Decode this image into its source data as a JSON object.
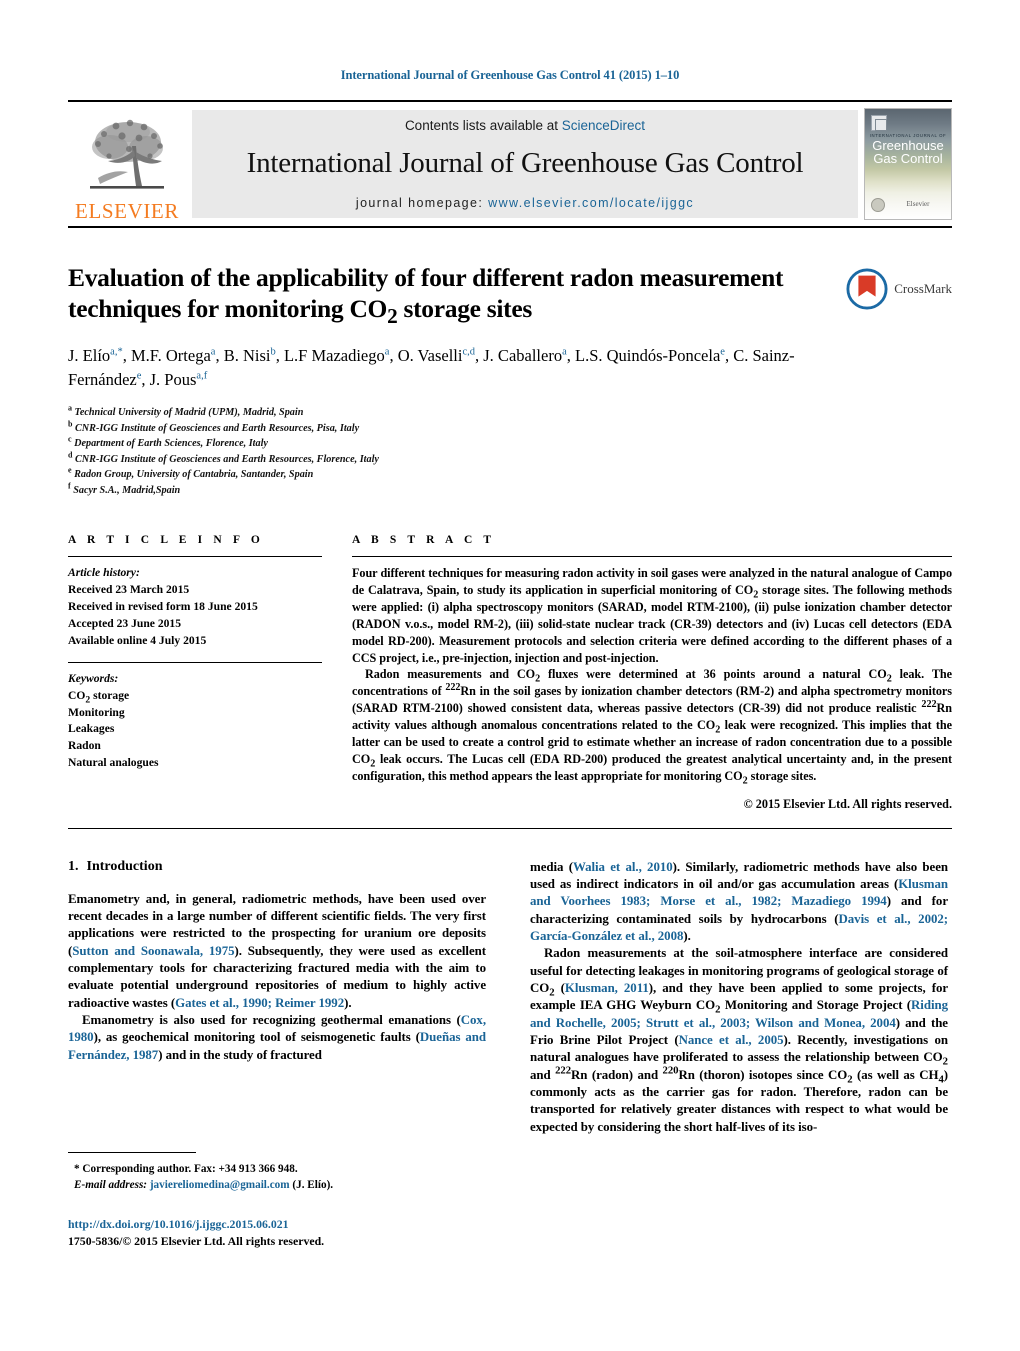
{
  "running_head": "International Journal of Greenhouse Gas Control 41 (2015) 1–10",
  "masthead": {
    "publisher": "ELSEVIER",
    "contents_prefix": "Contents lists available at ",
    "contents_link": "ScienceDirect",
    "journal_title": "International Journal of Greenhouse Gas Control",
    "homepage_label": "journal homepage:",
    "homepage_url": "www.elsevier.com/locate/ijggc",
    "cover": {
      "superline": "INTERNATIONAL JOURNAL OF",
      "line1": "Greenhouse",
      "line2": "Gas Control",
      "badge_word": "Elsevier"
    }
  },
  "article": {
    "title_line1": "Evaluation of the applicability of four different radon measurement",
    "title_line2_pre": "techniques for monitoring CO",
    "title_line2_sub": "2",
    "title_line2_post": " storage sites",
    "crossmark_label": "CrossMark",
    "authors_html": "J. Elío<sup>a,*</sup>, M.F. Ortega<sup>a</sup>, B. Nisi<sup>b</sup>, L.F Mazadiego<sup>a</sup>, O. Vaselli<sup>c,d</sup>, J. Caballero<sup>a</sup>, L.S. Quindós-Poncela<sup>e</sup>, C. Sainz-Fernández<sup>e</sup>, J. Pous<sup>a,f</sup>",
    "affiliations": [
      {
        "mark": "a",
        "text": "Technical University of Madrid (UPM), Madrid, Spain"
      },
      {
        "mark": "b",
        "text": "CNR-IGG Institute of Geosciences and Earth Resources, Pisa, Italy"
      },
      {
        "mark": "c",
        "text": "Department of Earth Sciences, Florence, Italy"
      },
      {
        "mark": "d",
        "text": "CNR-IGG Institute of Geosciences and Earth Resources, Florence, Italy"
      },
      {
        "mark": "e",
        "text": "Radon Group, University of Cantabria, Santander, Spain"
      },
      {
        "mark": "f",
        "text": "Sacyr S.A., Madrid,Spain"
      }
    ]
  },
  "article_info": {
    "heading": "A R T I C L E   I N F O",
    "history_label": "Article history:",
    "history": [
      "Received 23 March 2015",
      "Received in revised form 18 June 2015",
      "Accepted 23 June 2015",
      "Available online 4 July 2015"
    ],
    "keywords_label": "Keywords:",
    "keywords": [
      "CO2 storage",
      "Monitoring",
      "Leakages",
      "Radon",
      "Natural analogues"
    ]
  },
  "abstract": {
    "heading": "A B S T R A C T",
    "paragraph1": "Four different techniques for measuring radon activity in soil gases were analyzed in the natural analogue of Campo de Calatrava, Spain, to study its application in superficial monitoring of CO2 storage sites. The following methods were applied: (i) alpha spectroscopy monitors (SARAD, model RTM-2100), (ii) pulse ionization chamber detector (RADON v.o.s., model RM-2), (iii) solid-state nuclear track (CR-39) detectors and (iv) Lucas cell detectors (EDA model RD-200). Measurement protocols and selection criteria were defined according to the different phases of a CCS project, i.e., pre-injection, injection and post-injection.",
    "paragraph2": "Radon measurements and CO2 fluxes were determined at 36 points around a natural CO2 leak. The concentrations of 222Rn in the soil gases by ionization chamber detectors (RM-2) and alpha spectrometry monitors (SARAD RTM-2100) showed consistent data, whereas passive detectors (CR-39) did not produce realistic 222Rn activity values although anomalous concentrations related to the CO2 leak were recognized. This implies that the latter can be used to create a control grid to estimate whether an increase of radon concentration due to a possible CO2 leak occurs. The Lucas cell (EDA RD-200) produced the greatest analytical uncertainty and, in the present configuration, this method appears the least appropriate for monitoring CO2 storage sites.",
    "copyright": "© 2015 Elsevier Ltd. All rights reserved."
  },
  "introduction": {
    "number": "1.",
    "title": "Introduction",
    "left_paragraphs": [
      "Emanometry and, in general, radiometric methods, have been used over recent decades in a large number of different scientific fields. The very first applications were restricted to the prospecting for uranium ore deposits (Sutton and Soonawala, 1975). Subsequently, they were used as excellent complementary tools for characterizing fractured media with the aim to evaluate potential underground repositories of medium to highly active radioactive wastes (Gates et al., 1990; Reimer 1992).",
      "Emanometry is also used for recognizing geothermal emanations (Cox, 1980), as geochemical monitoring tool of seismogenetic faults (Dueñas and Fernández, 1987) and in the study of fractured"
    ],
    "right_paragraphs": [
      "media (Walia et al., 2010). Similarly, radiometric methods have also been used as indirect indicators in oil and/or gas accumulation areas (Klusman and Voorhees 1983; Morse et al., 1982; Mazadiego 1994) and for characterizing contaminated soils by hydrocarbons (Davis et al., 2002; García-González et al., 2008).",
      "Radon measurements at the soil-atmosphere interface are considered useful for detecting leakages in monitoring programs of geological storage of CO2 (Klusman, 2011), and they have been applied to some projects, for example IEA GHG Weyburn CO2 Monitoring and Storage Project (Riding and Rochelle, 2005; Strutt et al., 2003; Wilson and Monea, 2004) and the Frio Brine Pilot Project (Nance et al., 2005). Recently, investigations on natural analogues have proliferated to assess the relationship between CO2 and 222Rn (radon) and 220Rn (thoron) isotopes since CO2 (as well as CH4) commonly acts as the carrier gas for radon. Therefore, radon can be transported for relatively greater distances with respect to what would be expected by considering the short half-lives of its iso-"
    ]
  },
  "footnotes": {
    "corresponding": "* Corresponding author. Fax: +34 913 366 948.",
    "email_label": "E-mail address:",
    "email": "javiereliomedina@gmail.com",
    "email_suffix": "(J. Elío).",
    "doi": "http://dx.doi.org/10.1016/j.ijggc.2015.06.021",
    "issn": "1750-5836/© 2015 Elsevier Ltd. All rights reserved."
  },
  "colors": {
    "link": "#1a6496",
    "elsevier_orange": "#F47B20",
    "band_gray": "#e9e9e9"
  }
}
